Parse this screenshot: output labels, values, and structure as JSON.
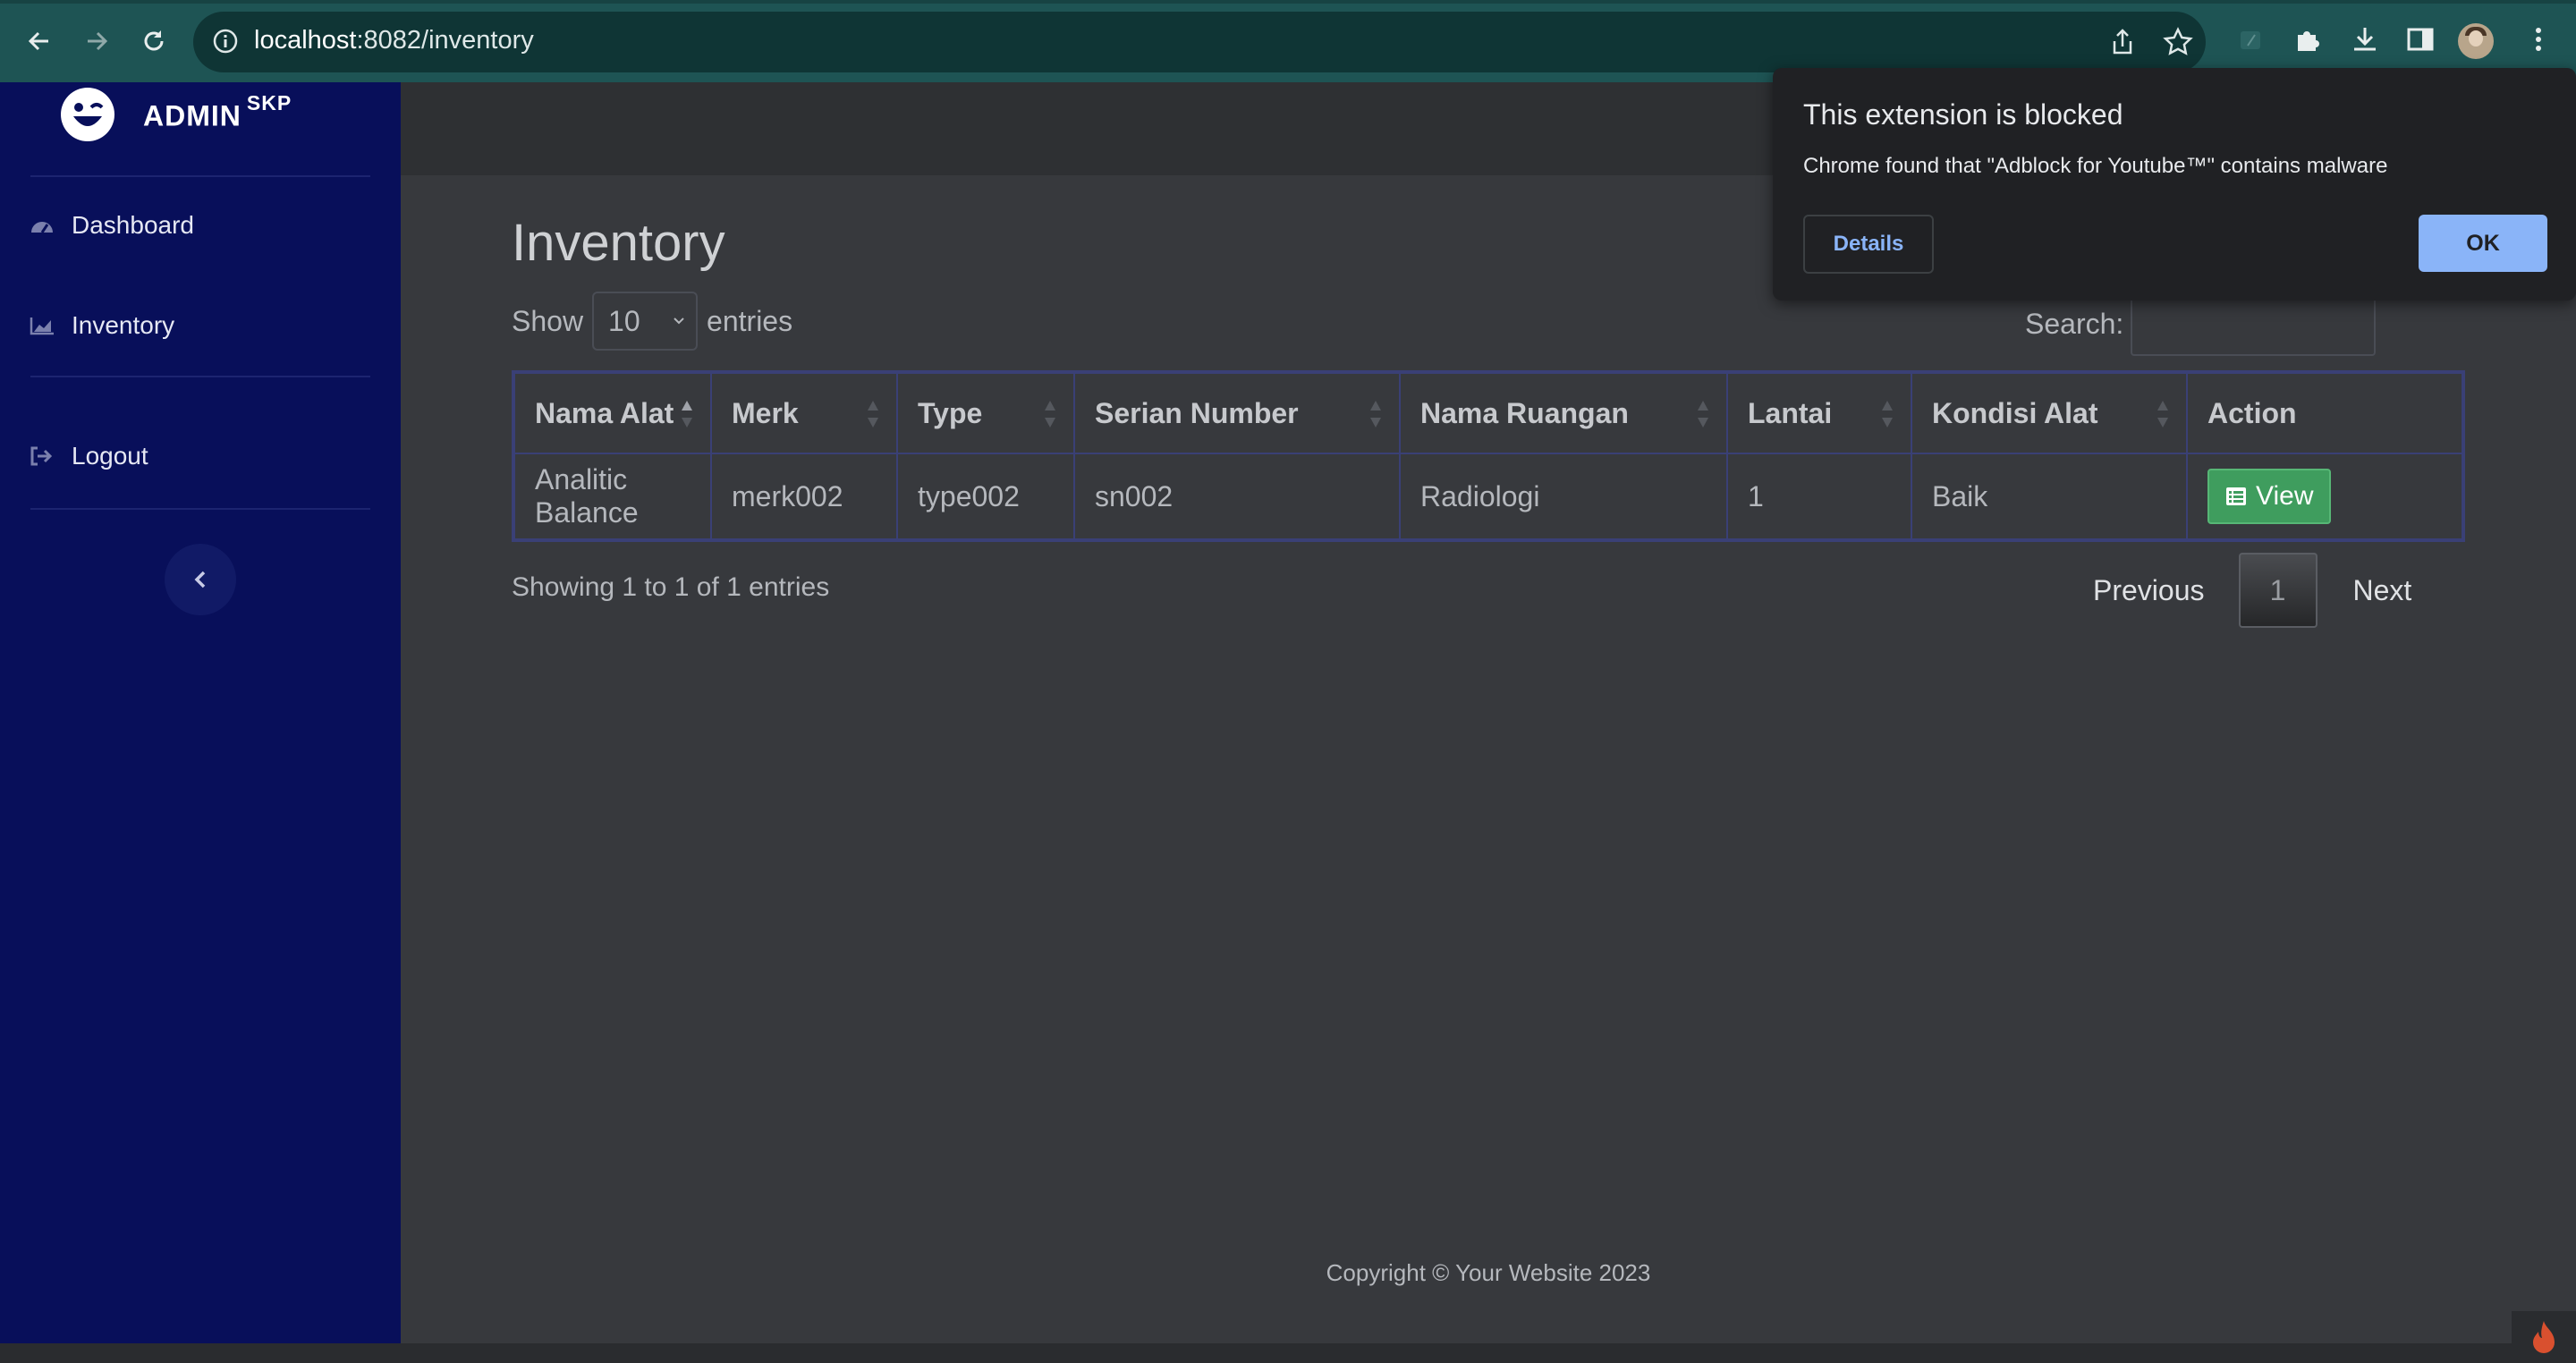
{
  "browser": {
    "url_host": "localhost",
    "url_path": ":8082/inventory"
  },
  "sidebar": {
    "brand": "ADMIN",
    "brand_sup": "SKP",
    "items": [
      {
        "label": "Dashboard",
        "icon": "tachometer-icon"
      },
      {
        "label": "Inventory",
        "icon": "area-chart-icon"
      },
      {
        "label": "Logout",
        "icon": "sign-out-icon"
      }
    ]
  },
  "main": {
    "title": "Inventory",
    "length": {
      "show": "Show",
      "value": "10",
      "entries": "entries"
    },
    "search_label": "Search:",
    "table": {
      "columns": [
        "Nama Alat",
        "Merk",
        "Type",
        "Serian Number",
        "Nama Ruangan",
        "Lantai",
        "Kondisi Alat",
        "Action"
      ],
      "rows": [
        {
          "nama_alat": "Analitic Balance",
          "merk": "merk002",
          "type": "type002",
          "serial": "sn002",
          "ruangan": "Radiologi",
          "lantai": "1",
          "kondisi": "Baik",
          "action": "View"
        }
      ]
    },
    "info": "Showing 1 to 1 of 1 entries",
    "pager": {
      "previous": "Previous",
      "current": "1",
      "next": "Next"
    },
    "footer": "Copyright © Your Website 2023"
  },
  "popup": {
    "title": "This extension is blocked",
    "message": "Chrome found that \"Adblock for Youtube™\" contains malware",
    "details": "Details",
    "ok": "OK"
  },
  "colors": {
    "sidebar_bg": "#080f5a",
    "chrome_bg": "#1e5454",
    "view_button": "#3f9d5e",
    "popup_ok": "#8ab4f8"
  }
}
